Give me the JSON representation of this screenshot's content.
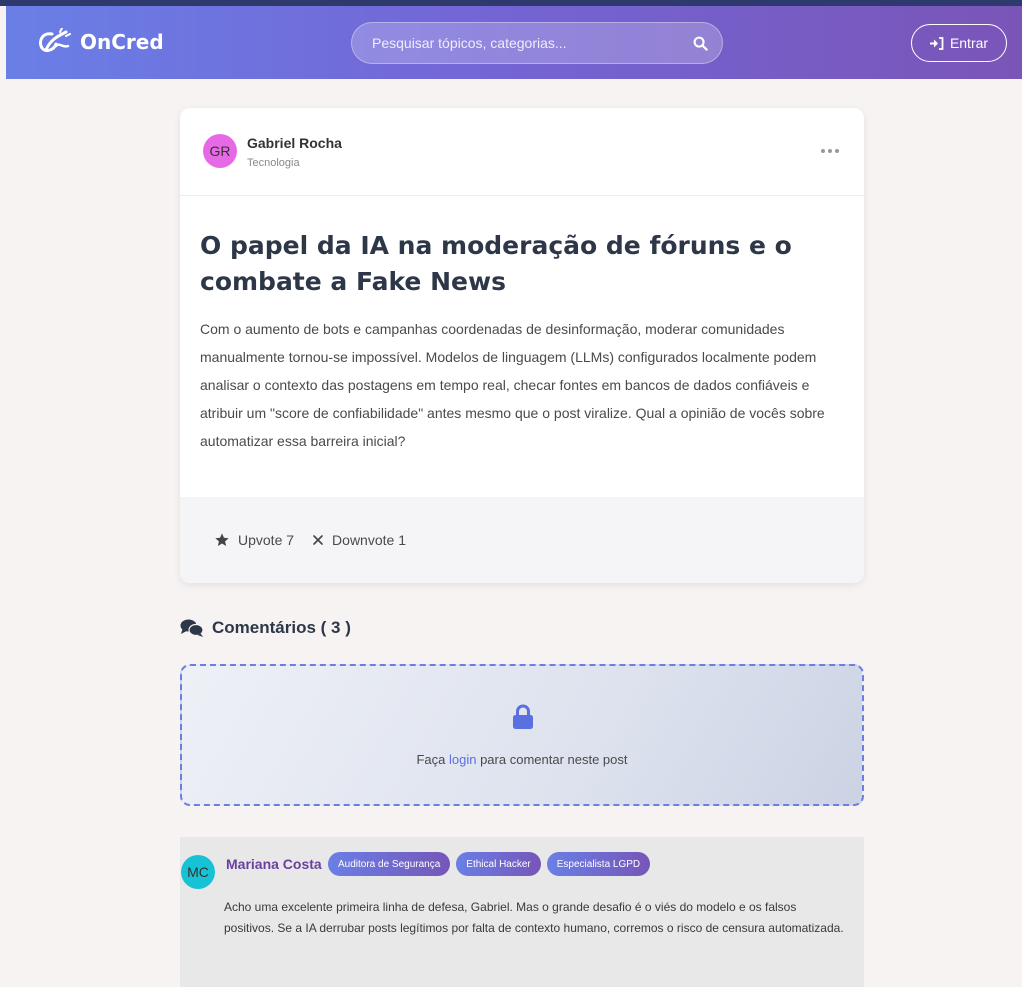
{
  "navbar": {
    "brand": "OnCred",
    "search_placeholder": "Pesquisar tópicos, categorias...",
    "login_label": "Entrar"
  },
  "post": {
    "author": {
      "initials": "GR",
      "name": "Gabriel Rocha",
      "category": "Tecnologia"
    },
    "title": "O papel da IA na moderação de fóruns e o combate a Fake News",
    "body": "Com o aumento de bots e campanhas coordenadas de desinformação, moderar comunidades manualmente tornou-se impossível. Modelos de linguagem (LLMs) configurados localmente podem analisar o contexto das postagens em tempo real, checar fontes em bancos de dados confiáveis e atribuir um \"score de confiabilidade\" antes mesmo que o post viralize. Qual a opinião de vocês sobre automatizar essa barreira inicial?",
    "upvote_label": "Upvote 7",
    "downvote_label": "Downvote 1"
  },
  "comments": {
    "title": "Comentários ( 3 )",
    "login_prompt": {
      "before": "Faça ",
      "link": "login",
      "after": " para comentar neste post"
    },
    "items": [
      {
        "initials": "MC",
        "name": "Mariana Costa",
        "badges": [
          "Auditora de Segurança",
          "Ethical Hacker",
          "Especialista LGPD"
        ],
        "text": "Acho uma excelente primeira linha de defesa, Gabriel. Mas o grande desafio é o viés do modelo e os falsos positivos. Se a IA derrubar posts legítimos por falta de contexto humano, corremos o risco de censura automatizada."
      }
    ]
  },
  "colors": {
    "accent": "#6a7fe6",
    "accent_dark": "#7656b8",
    "avatar_gr": "#e66ae6",
    "avatar_mc": "#17c2d4"
  }
}
